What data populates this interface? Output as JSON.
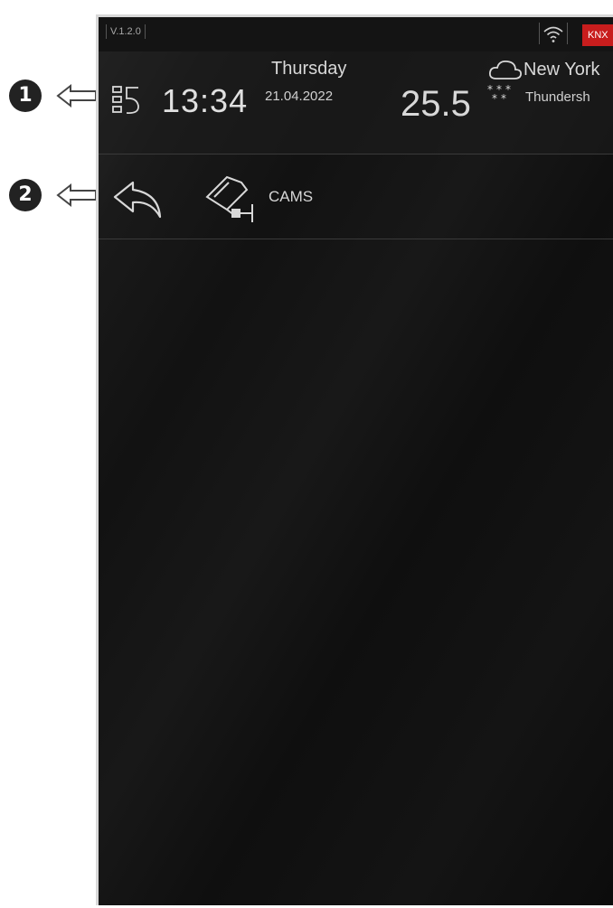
{
  "callouts": [
    {
      "number": "1"
    },
    {
      "number": "2"
    }
  ],
  "status_bar": {
    "version": "V.1.2.0",
    "connection_badge": "KNX",
    "badge_color": "#c81d1d",
    "wifi_icon": "wifi-icon"
  },
  "header": {
    "menu_icon": "menu-icon",
    "time": "13:34",
    "weekday": "Thursday",
    "date": "21.04.2022",
    "temperature": "25.5",
    "weather_icon": "cloud-snow-icon",
    "city": "New York",
    "condition": "Thundersh"
  },
  "navigation": {
    "back_icon": "back-arrow-icon",
    "page_icon": "security-camera-icon",
    "page_title": "CAMS"
  },
  "colors": {
    "background": "#121212",
    "text": "#d8d8d8",
    "accent": "#c81d1d"
  }
}
